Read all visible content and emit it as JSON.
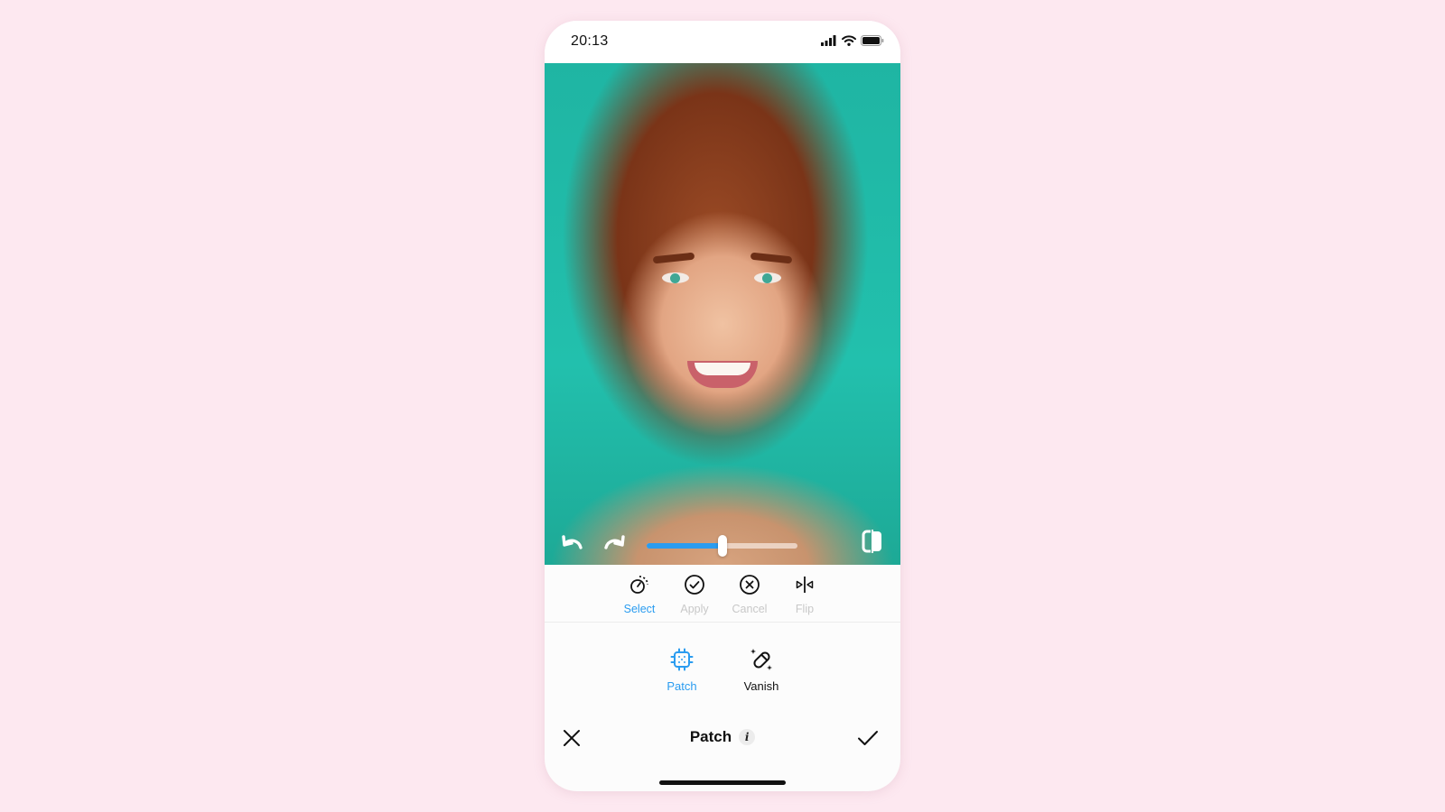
{
  "status_bar": {
    "time": "20:13",
    "icons": [
      "cellular-signal-icon",
      "wifi-icon",
      "battery-icon"
    ]
  },
  "photo": {
    "description": "Portrait of smiling woman with auburn hair on teal background"
  },
  "photo_controls": {
    "undo_icon": "undo-icon",
    "redo_icon": "redo-icon",
    "compare_icon": "compare-icon",
    "brush_size_slider": {
      "value_percent": 50
    }
  },
  "tools": [
    {
      "label": "Select",
      "icon": "lasso-select-icon",
      "active": true
    },
    {
      "label": "Apply",
      "icon": "check-circle-icon",
      "active": false
    },
    {
      "label": "Cancel",
      "icon": "x-circle-icon",
      "active": false
    },
    {
      "label": "Flip",
      "icon": "flip-icon",
      "active": false
    }
  ],
  "modes": [
    {
      "label": "Patch",
      "icon": "patch-icon",
      "active": true
    },
    {
      "label": "Vanish",
      "icon": "vanish-bandage-icon",
      "active": false
    }
  ],
  "bottom_bar": {
    "title": "Patch",
    "info_label": "i",
    "close_icon": "close-icon",
    "confirm_icon": "checkmark-icon"
  },
  "colors": {
    "accent": "#2a9cf0",
    "background": "#fde8f0",
    "disabled_text": "#c8c8c8",
    "photo_background": "#22c0ad"
  }
}
